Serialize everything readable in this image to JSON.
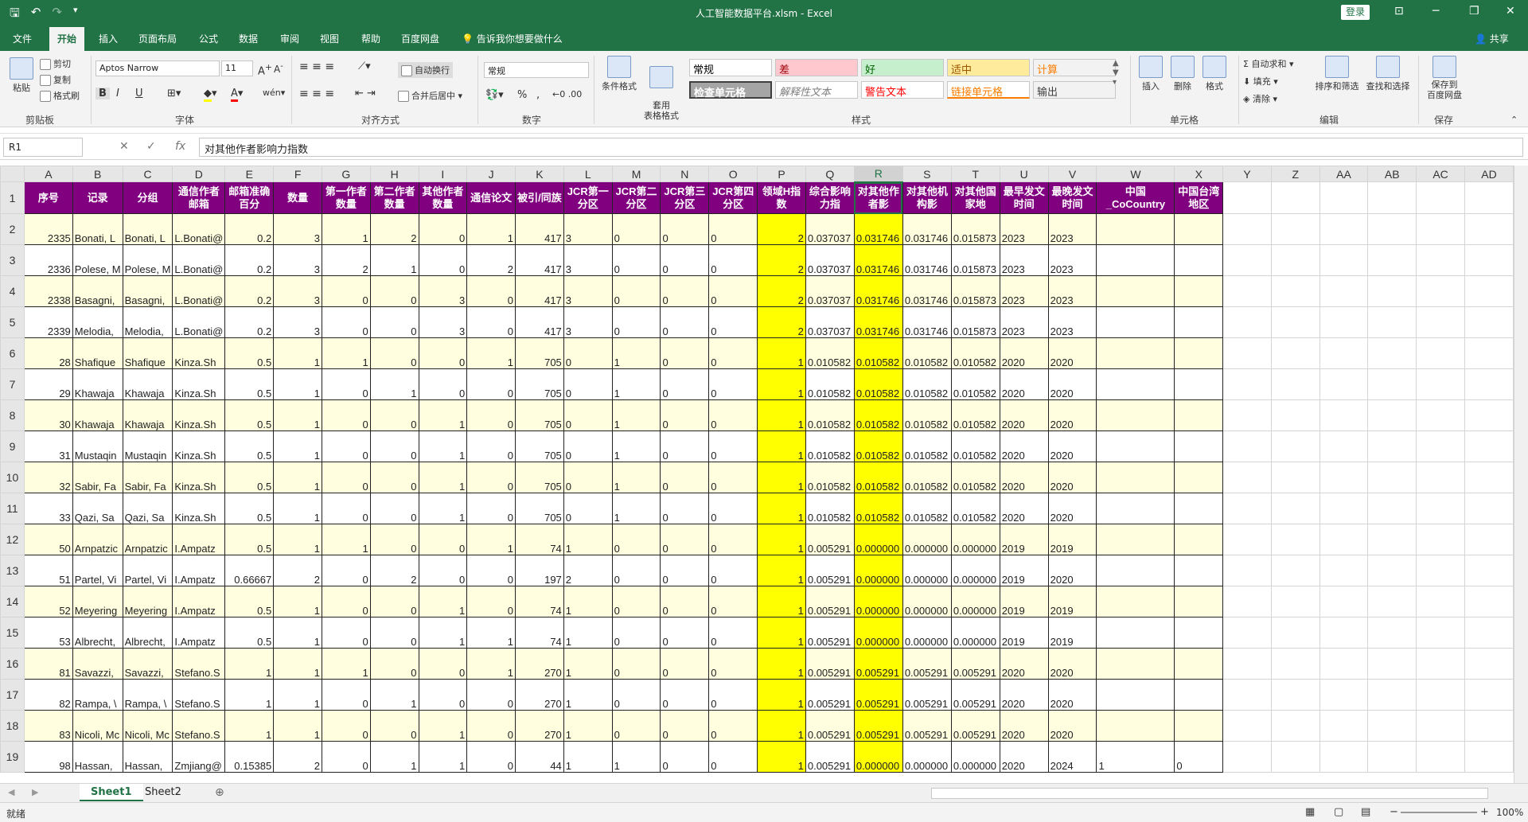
{
  "titlebar": {
    "title": "人工智能数据平台.xlsm - Excel",
    "login": "登录",
    "minimize": "─",
    "restore": "❐",
    "close": "✕",
    "ribbon_display": "⊡"
  },
  "tabs": [
    "文件",
    "开始",
    "插入",
    "页面布局",
    "公式",
    "数据",
    "审阅",
    "视图",
    "帮助",
    "百度网盘"
  ],
  "tell_me": "告诉我你想要做什么",
  "share": "共享",
  "ribbon": {
    "clipboard": {
      "label": "剪贴板",
      "paste": "粘贴",
      "cut": "剪切",
      "copy": "复制",
      "format_painter": "格式刷"
    },
    "font": {
      "label": "字体",
      "font_name": "Aptos Narrow",
      "font_size": "11",
      "bold": "B",
      "italic": "I",
      "underline": "U"
    },
    "alignment": {
      "label": "对齐方式",
      "wrap": "自动换行",
      "merge": "合并后居中"
    },
    "number": {
      "label": "数字",
      "format": "常规",
      "percent": "%",
      "comma": ","
    },
    "styles": {
      "label": "样式",
      "cond_format": "条件格式",
      "table_format": "套用\n表格格式",
      "cells": [
        {
          "text": "常规",
          "bg": "#ffffff",
          "fg": "#000000"
        },
        {
          "text": "差",
          "bg": "#ffc7ce",
          "fg": "#9c0006"
        },
        {
          "text": "好",
          "bg": "#c6efce",
          "fg": "#006100"
        },
        {
          "text": "适中",
          "bg": "#ffeb9c",
          "fg": "#9c5700"
        },
        {
          "text": "计算",
          "bg": "#f2f2f2",
          "fg": "#fa7d00"
        },
        {
          "text": "检查单元格",
          "bg": "#a5a5a5",
          "fg": "#ffffff"
        },
        {
          "text": "解释性文本",
          "bg": "#ffffff",
          "fg": "#7f7f7f"
        },
        {
          "text": "警告文本",
          "bg": "#ffffff",
          "fg": "#ff0000"
        },
        {
          "text": "链接单元格",
          "bg": "#ffffff",
          "fg": "#fa7d00"
        },
        {
          "text": "输出",
          "bg": "#f2f2f2",
          "fg": "#3f3f3f"
        }
      ]
    },
    "cells_group": {
      "label": "单元格",
      "insert": "插入",
      "delete": "删除",
      "format": "格式"
    },
    "editing": {
      "label": "编辑",
      "autosum": "自动求和",
      "fill": "填充",
      "clear": "清除",
      "sort": "排序和筛选",
      "find": "查找和选择"
    },
    "save": {
      "label": "保存",
      "save_baidu": "保存到\n百度网盘"
    }
  },
  "formula_bar": {
    "name_box": "R1",
    "formula": "对其他作者影响力指数",
    "cancel": "✕",
    "enter": "✓",
    "fx": "fx"
  },
  "columns": [
    "A",
    "B",
    "C",
    "D",
    "E",
    "F",
    "G",
    "H",
    "I",
    "J",
    "K",
    "L",
    "M",
    "N",
    "O",
    "P",
    "Q",
    "R",
    "S",
    "T",
    "U",
    "V",
    "W",
    "X",
    "Y",
    "Z",
    "AA",
    "AB",
    "AC",
    "AD"
  ],
  "header_row": [
    "序号",
    "记录",
    "分组",
    "通信作者邮箱",
    "邮箱准确百分",
    "数量",
    "第一作者数量",
    "第二作者数量",
    "其他作者数量",
    "通信论文",
    "被引/同族",
    "JCR第一分区",
    "JCR第二分区",
    "JCR第三分区",
    "JCR第四分区",
    "领域H指数",
    "综合影响力指",
    "对其他作者影",
    "对其他机构影",
    "对其他国家地",
    "最早发文时间",
    "最晚发文时间",
    "中国_CoCountry",
    "中国台湾地区"
  ],
  "rows": [
    {
      "n": "2",
      "c": [
        "2335",
        "Bonati, L",
        "Bonati, L",
        "L.Bonati@",
        "0.2",
        "3",
        "1",
        "2",
        "0",
        "1",
        "417",
        "3",
        "0",
        "0",
        "0",
        "2",
        "0.037037",
        "0.031746",
        "0.031746",
        "0.015873",
        "2023",
        "2023",
        "",
        ""
      ]
    },
    {
      "n": "3",
      "c": [
        "2336",
        "Polese, M",
        "Polese, M",
        "L.Bonati@",
        "0.2",
        "3",
        "2",
        "1",
        "0",
        "2",
        "417",
        "3",
        "0",
        "0",
        "0",
        "2",
        "0.037037",
        "0.031746",
        "0.031746",
        "0.015873",
        "2023",
        "2023",
        "",
        ""
      ]
    },
    {
      "n": "4",
      "c": [
        "2338",
        "Basagni,",
        "Basagni,",
        "L.Bonati@",
        "0.2",
        "3",
        "0",
        "0",
        "3",
        "0",
        "417",
        "3",
        "0",
        "0",
        "0",
        "2",
        "0.037037",
        "0.031746",
        "0.031746",
        "0.015873",
        "2023",
        "2023",
        "",
        ""
      ]
    },
    {
      "n": "5",
      "c": [
        "2339",
        "Melodia,",
        "Melodia,",
        "L.Bonati@",
        "0.2",
        "3",
        "0",
        "0",
        "3",
        "0",
        "417",
        "3",
        "0",
        "0",
        "0",
        "2",
        "0.037037",
        "0.031746",
        "0.031746",
        "0.015873",
        "2023",
        "2023",
        "",
        ""
      ]
    },
    {
      "n": "6",
      "c": [
        "28",
        "Shafique",
        "Shafique",
        "Kinza.Sh",
        "0.5",
        "1",
        "1",
        "0",
        "0",
        "1",
        "705",
        "0",
        "1",
        "0",
        "0",
        "1",
        "0.010582",
        "0.010582",
        "0.010582",
        "0.010582",
        "2020",
        "2020",
        "",
        ""
      ]
    },
    {
      "n": "7",
      "c": [
        "29",
        "Khawaja",
        "Khawaja",
        "Kinza.Sh",
        "0.5",
        "1",
        "0",
        "1",
        "0",
        "0",
        "705",
        "0",
        "1",
        "0",
        "0",
        "1",
        "0.010582",
        "0.010582",
        "0.010582",
        "0.010582",
        "2020",
        "2020",
        "",
        ""
      ]
    },
    {
      "n": "8",
      "c": [
        "30",
        "Khawaja",
        "Khawaja",
        "Kinza.Sh",
        "0.5",
        "1",
        "0",
        "0",
        "1",
        "0",
        "705",
        "0",
        "1",
        "0",
        "0",
        "1",
        "0.010582",
        "0.010582",
        "0.010582",
        "0.010582",
        "2020",
        "2020",
        "",
        ""
      ]
    },
    {
      "n": "9",
      "c": [
        "31",
        "Mustaqin",
        "Mustaqin",
        "Kinza.Sh",
        "0.5",
        "1",
        "0",
        "0",
        "1",
        "0",
        "705",
        "0",
        "1",
        "0",
        "0",
        "1",
        "0.010582",
        "0.010582",
        "0.010582",
        "0.010582",
        "2020",
        "2020",
        "",
        ""
      ]
    },
    {
      "n": "10",
      "c": [
        "32",
        "Sabir, Fa",
        "Sabir, Fa",
        "Kinza.Sh",
        "0.5",
        "1",
        "0",
        "0",
        "1",
        "0",
        "705",
        "0",
        "1",
        "0",
        "0",
        "1",
        "0.010582",
        "0.010582",
        "0.010582",
        "0.010582",
        "2020",
        "2020",
        "",
        ""
      ]
    },
    {
      "n": "11",
      "c": [
        "33",
        "Qazi, Sa",
        "Qazi, Sa",
        "Kinza.Sh",
        "0.5",
        "1",
        "0",
        "0",
        "1",
        "0",
        "705",
        "0",
        "1",
        "0",
        "0",
        "1",
        "0.010582",
        "0.010582",
        "0.010582",
        "0.010582",
        "2020",
        "2020",
        "",
        ""
      ]
    },
    {
      "n": "12",
      "c": [
        "50",
        "Arnpatzic",
        "Arnpatzic",
        "I.Ampatz",
        "0.5",
        "1",
        "1",
        "0",
        "0",
        "1",
        "74",
        "1",
        "0",
        "0",
        "0",
        "1",
        "0.005291",
        "0.000000",
        "0.000000",
        "0.000000",
        "2019",
        "2019",
        "",
        ""
      ]
    },
    {
      "n": "13",
      "c": [
        "51",
        "Partel, Vi",
        "Partel, Vi",
        "I.Ampatz",
        "0.66667",
        "2",
        "0",
        "2",
        "0",
        "0",
        "197",
        "2",
        "0",
        "0",
        "0",
        "1",
        "0.005291",
        "0.000000",
        "0.000000",
        "0.000000",
        "2019",
        "2020",
        "",
        ""
      ]
    },
    {
      "n": "14",
      "c": [
        "52",
        "Meyering",
        "Meyering",
        "I.Ampatz",
        "0.5",
        "1",
        "0",
        "0",
        "1",
        "0",
        "74",
        "1",
        "0",
        "0",
        "0",
        "1",
        "0.005291",
        "0.000000",
        "0.000000",
        "0.000000",
        "2019",
        "2019",
        "",
        ""
      ]
    },
    {
      "n": "15",
      "c": [
        "53",
        "Albrecht,",
        "Albrecht,",
        "I.Ampatz",
        "0.5",
        "1",
        "0",
        "0",
        "1",
        "1",
        "74",
        "1",
        "0",
        "0",
        "0",
        "1",
        "0.005291",
        "0.000000",
        "0.000000",
        "0.000000",
        "2019",
        "2019",
        "",
        ""
      ]
    },
    {
      "n": "16",
      "c": [
        "81",
        "Savazzi,",
        "Savazzi,",
        "Stefano.S",
        "1",
        "1",
        "1",
        "0",
        "0",
        "1",
        "270",
        "1",
        "0",
        "0",
        "0",
        "1",
        "0.005291",
        "0.005291",
        "0.005291",
        "0.005291",
        "2020",
        "2020",
        "",
        ""
      ]
    },
    {
      "n": "17",
      "c": [
        "82",
        "Rampa, \\",
        "Rampa, \\",
        "Stefano.S",
        "1",
        "1",
        "0",
        "1",
        "0",
        "0",
        "270",
        "1",
        "0",
        "0",
        "0",
        "1",
        "0.005291",
        "0.005291",
        "0.005291",
        "0.005291",
        "2020",
        "2020",
        "",
        ""
      ]
    },
    {
      "n": "18",
      "c": [
        "83",
        "Nicoli, Mc",
        "Nicoli, Mc",
        "Stefano.S",
        "1",
        "1",
        "0",
        "0",
        "1",
        "0",
        "270",
        "1",
        "0",
        "0",
        "0",
        "1",
        "0.005291",
        "0.005291",
        "0.005291",
        "0.005291",
        "2020",
        "2020",
        "",
        ""
      ]
    },
    {
      "n": "19",
      "c": [
        "98",
        "Hassan,",
        "Hassan,",
        "Zmjiang@",
        "0.15385",
        "2",
        "0",
        "1",
        "1",
        "0",
        "44",
        "1",
        "1",
        "0",
        "0",
        "1",
        "0.005291",
        "0.000000",
        "0.000000",
        "0.000000",
        "2020",
        "2024",
        "1",
        "0"
      ]
    }
  ],
  "sheets": [
    "Sheet1",
    "Sheet2"
  ],
  "status": {
    "ready": "就绪",
    "zoom": "100%"
  }
}
